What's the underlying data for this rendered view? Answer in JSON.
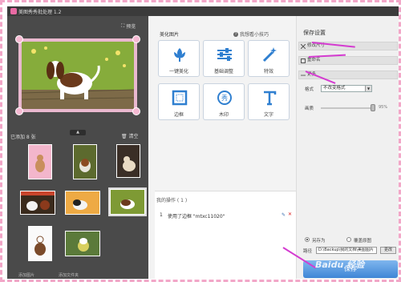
{
  "window": {
    "title": "美图秀秀批处理 1.2"
  },
  "left": {
    "preview_btn": "预览",
    "added_label": "已添加 8 张",
    "clear_btn": "清空",
    "bottom": [
      "添加图片",
      "添加文件夹"
    ]
  },
  "middle": {
    "heading": "美化图片",
    "tips": "我想看小技巧",
    "tools": [
      {
        "label": "一键美化"
      },
      {
        "label": "基础调整"
      },
      {
        "label": "特效"
      },
      {
        "label": "边框"
      },
      {
        "label": "木印"
      },
      {
        "label": "文字"
      }
    ],
    "history": {
      "header": "我的操作 ( 1 )",
      "rows": [
        {
          "num": "1",
          "text": "使用了边框 \"mtxc11020\""
        }
      ]
    }
  },
  "right": {
    "heading": "保存设置",
    "sections": [
      "修改尺寸",
      "重命名",
      "更多"
    ],
    "format_label": "格式",
    "format_value": "不改变格式",
    "quality_label": "画质",
    "quality_pct": "95%",
    "save_as_label": "另存为",
    "overwrite_label": "覆盖原图",
    "path_label": "路径",
    "path_value": "D:\\Backup\\我的文档\\美图图片",
    "browse": "更改",
    "save_btn": "保存"
  },
  "watermark": "Baidu 经验",
  "colors": {
    "frame": "#f2a7c8",
    "accent": "#3f86d6",
    "arrow": "#d43bd0"
  }
}
